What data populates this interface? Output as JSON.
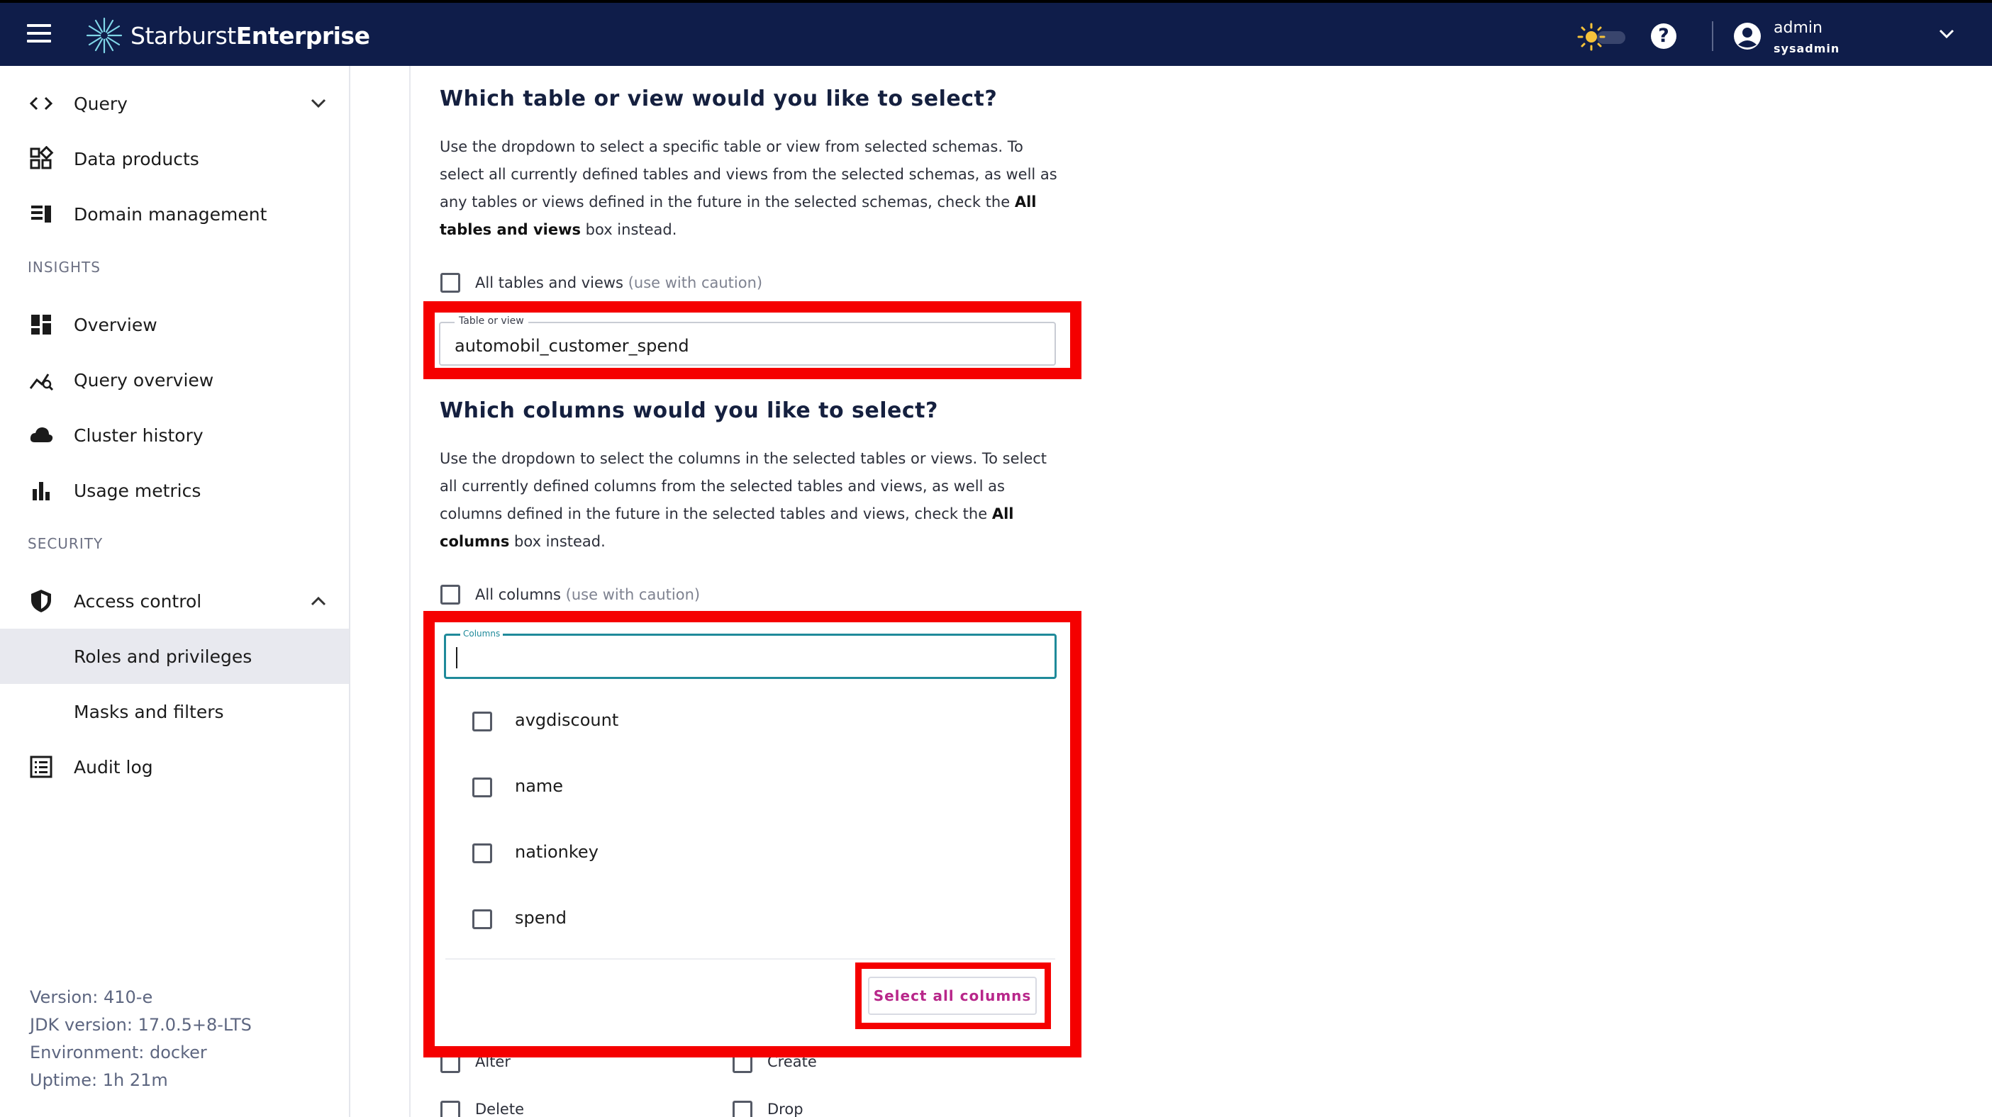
{
  "header": {
    "brand_light": "Starburst",
    "brand_bold": "Enterprise",
    "user_name": "admin",
    "user_role": "sysadmin"
  },
  "sidebar": {
    "items": [
      {
        "label": "Query",
        "icon": "code-icon"
      },
      {
        "label": "Data products",
        "icon": "grid-icon"
      },
      {
        "label": "Domain management",
        "icon": "domain-icon"
      }
    ],
    "insights_label": "INSIGHTS",
    "insights_items": [
      {
        "label": "Overview",
        "icon": "dashboard-icon"
      },
      {
        "label": "Query overview",
        "icon": "chart-line-icon"
      },
      {
        "label": "Cluster history",
        "icon": "cloud-icon"
      },
      {
        "label": "Usage metrics",
        "icon": "bar-chart-icon"
      }
    ],
    "security_label": "SECURITY",
    "security_items": [
      {
        "label": "Access control",
        "icon": "shield-icon"
      },
      {
        "label": "Roles and privileges"
      },
      {
        "label": "Masks and filters"
      },
      {
        "label": "Audit log",
        "icon": "list-icon"
      }
    ],
    "version": "Version: 410-e",
    "jdk": "JDK version: 17.0.5+8-LTS",
    "environment": "Environment: docker",
    "uptime": "Uptime: 1h 21m"
  },
  "main": {
    "table_heading": "Which table or view would you like to select?",
    "table_para_1": "Use the dropdown to select a specific table or view from selected schemas. To select all currently defined tables and views from the selected schemas, as well as any tables or views defined in the future in the selected schemas, check the ",
    "table_para_bold": "All tables and views",
    "table_para_2": " box instead.",
    "all_tables_label": "All tables and views",
    "all_tables_caution": "(use with caution)",
    "table_field_legend": "Table or view",
    "table_field_value": "automobil_customer_spend",
    "columns_heading": "Which columns would you like to select?",
    "columns_para_1": "Use the dropdown to select the columns in the selected tables or views. To select all currently defined columns from the selected tables and views, as well as columns defined in the future in the selected tables and views, check the ",
    "columns_para_bold": "All columns",
    "columns_para_2": " box instead.",
    "all_columns_label": "All columns",
    "all_columns_caution": "(use with caution)",
    "columns_field_legend": "Columns",
    "column_options": [
      "avgdiscount",
      "name",
      "nationkey",
      "spend"
    ],
    "select_all_label": "Select all columns",
    "permissions": [
      "Alter",
      "Create",
      "Delete",
      "Drop"
    ]
  }
}
